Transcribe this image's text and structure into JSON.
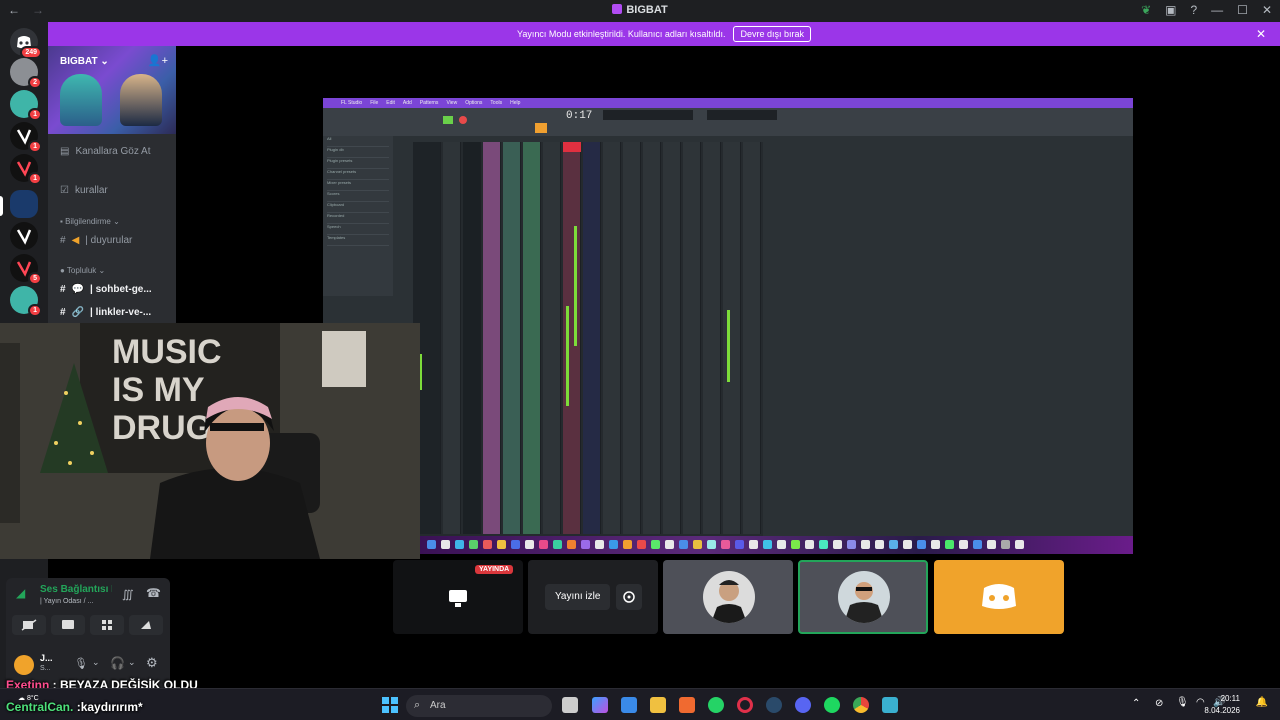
{
  "window": {
    "title": "BIGBAT",
    "nav_back": "←",
    "nav_forward": "→",
    "controls": [
      "—",
      "☐",
      "✕"
    ]
  },
  "banner": {
    "message": "Yayıncı Modu etkinleştirildi. Kullanıcı adları kısaltıldı.",
    "button": "Devre dışı bırak",
    "close": "✕"
  },
  "rail": {
    "badges": [
      "249",
      "2",
      "1",
      "1",
      "1",
      "1",
      "5",
      "1"
    ]
  },
  "server": {
    "name": "BIGBAT",
    "chevron": "⌄",
    "channels": [
      {
        "label": "Kanallara Göz At",
        "icon": "browse-icon"
      },
      {
        "label": "kurallar",
        "icon": "checkbox-icon"
      }
    ],
    "category_info": "Bilgilendirme",
    "info_channel": "| duyurular",
    "category_community": "Topluluk",
    "community_channels": [
      "| sohbet-ge...",
      "| linkler-ve-..."
    ]
  },
  "flstudio": {
    "app": "FL Studio",
    "menu": [
      "File",
      "Edit",
      "Add",
      "Patterns",
      "View",
      "Options",
      "Tools",
      "Help"
    ],
    "time": "0:17",
    "browser_items": [
      "All",
      "Plugin db",
      "Plugin presets",
      "Channel presets",
      "Mixer presets",
      "Scores",
      "Clipboard",
      "Recorded",
      "Speech",
      "Templates"
    ]
  },
  "tiles": {
    "live_badge": "YAYINDA",
    "watch_button": "Yayını izle"
  },
  "voice": {
    "status": "Ses Bağlantısı Kuruldu",
    "channel": "| Yayın Odası / ...",
    "user_name": "J...",
    "user_status": "S..."
  },
  "chat": [
    {
      "user": "Exetinn",
      "text": " : BEYAZA DEĞİŞİK OLDU",
      "color": "#ff4d8f"
    },
    {
      "user": "CentralCan.",
      "text": " :kaydırırım*",
      "color": "#4de07a"
    }
  ],
  "taskbar": {
    "search_placeholder": "Ara",
    "weather": "8°C",
    "time": "20:11",
    "date": "8.04.2026"
  },
  "colors": {
    "accent": "#9b36e8",
    "discord": "#f0a32b",
    "green": "#23a55a"
  }
}
